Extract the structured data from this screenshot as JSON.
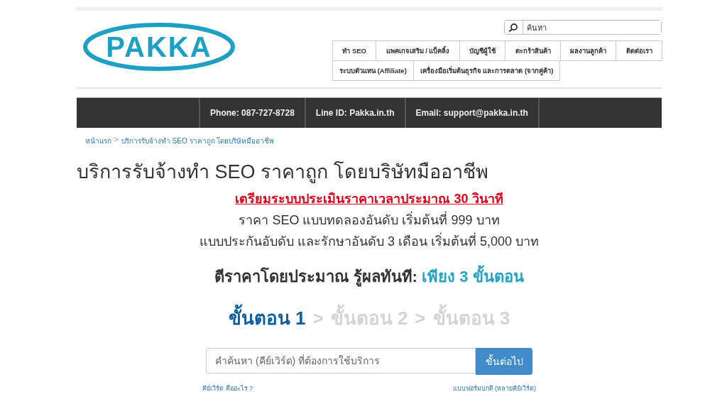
{
  "logo": {
    "text": "PAKKA"
  },
  "search": {
    "placeholder": "ค้นหา"
  },
  "nav": [
    {
      "label": "ทำ SEO"
    },
    {
      "label": "แพคเกจเสริม / แบ็คลิ้ง"
    },
    {
      "label": "บัญชีผู้ใช้"
    },
    {
      "label": "ตะกร้าสินค้า"
    },
    {
      "label": "ผลงานลูกค้า"
    },
    {
      "label": "ติดต่อเรา"
    },
    {
      "label": "ระบบตัวแทน (Affiliate)"
    },
    {
      "label": "เครื่องมือเริ่มต้นธุรกิจ และการตลาด (จากคู่ค้า)"
    }
  ],
  "contact_bar": [
    "Phone: 087-727-8728",
    "Line ID: Pakka.in.th",
    "Email: support@pakka.in.th"
  ],
  "breadcrumb": {
    "items": [
      "หน้าแรก",
      "บริการรับจ้างทำ SEO ราคาถูก โดยบริษัทมืออาชีพ"
    ],
    "separator": ">"
  },
  "title": "บริการรับจ้างทำ SEO ราคาถูก โดยบริษัทมืออาชีพ",
  "notice": "เตรียมระบบประเมินราคาเวลาประมาณ 30 วินาที",
  "price_lines": [
    "ราคา SEO แบบทดลองอันดับ เริ่มต้นที่ 999 บาท",
    "แบบประกันอับดับ และรักษาอันดับ 3 เดือน เริ่มต้นที่ 5,000 บาท"
  ],
  "headline": "ตีราคาโดยประมาณ รู้ผลทันที: *เพียง 3 ขั้นตอน*",
  "steps": {
    "separator": ">",
    "items": [
      {
        "label": "ขั้นตอน 1",
        "selected": true
      },
      {
        "label": "ขั้นตอน 2",
        "selected": false
      },
      {
        "label": "ขั้นตอน 3",
        "selected": false
      }
    ]
  },
  "keyword_form": {
    "placeholder": "คำค้นหา (คีย์เวิร์ด) ที่ต้องการใช้บริการ",
    "button": "ขั้นต่อไป"
  },
  "links": [
    "คีย์เวิร์ด คืออะไร ?",
    "แบบฟอร์มปกติ (หลายคีย์เวิร์ด)"
  ]
}
